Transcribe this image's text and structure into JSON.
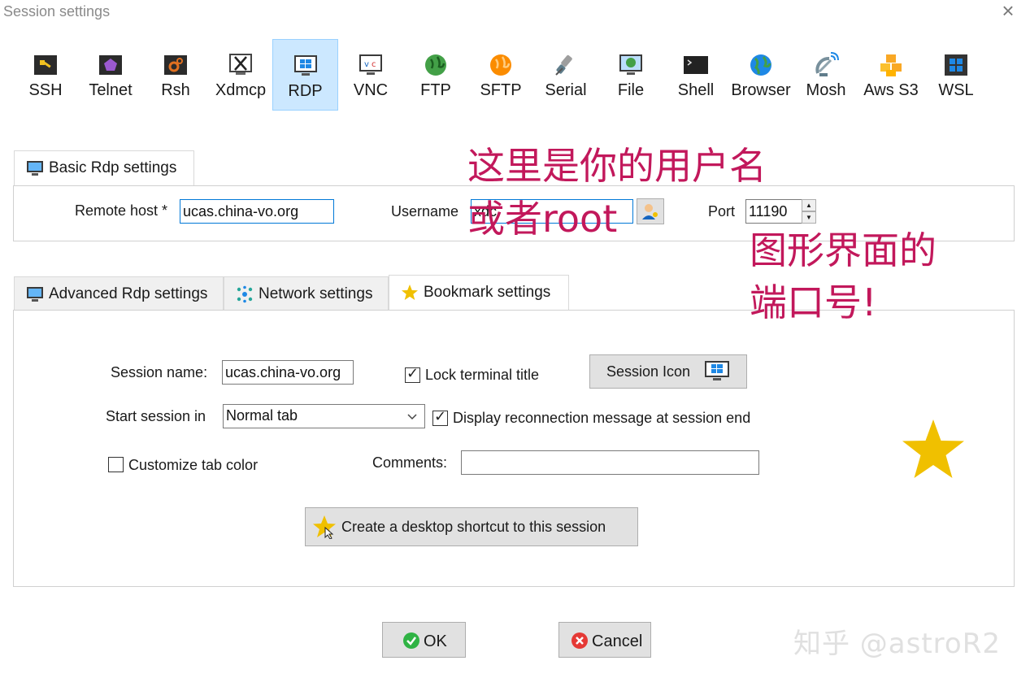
{
  "window": {
    "title": "Session settings",
    "close": "×"
  },
  "session_types": [
    {
      "label": "SSH",
      "icon": "ssh-icon"
    },
    {
      "label": "Telnet",
      "icon": "telnet-icon"
    },
    {
      "label": "Rsh",
      "icon": "rsh-icon"
    },
    {
      "label": "Xdmcp",
      "icon": "xdmcp-icon"
    },
    {
      "label": "RDP",
      "icon": "rdp-icon",
      "selected": true
    },
    {
      "label": "VNC",
      "icon": "vnc-icon"
    },
    {
      "label": "FTP",
      "icon": "ftp-icon"
    },
    {
      "label": "SFTP",
      "icon": "sftp-icon"
    },
    {
      "label": "Serial",
      "icon": "serial-icon"
    },
    {
      "label": "File",
      "icon": "file-icon"
    },
    {
      "label": "Shell",
      "icon": "shell-icon"
    },
    {
      "label": "Browser",
      "icon": "browser-icon"
    },
    {
      "label": "Mosh",
      "icon": "mosh-icon"
    },
    {
      "label": "Aws S3",
      "icon": "aws-s3-icon"
    },
    {
      "label": "WSL",
      "icon": "wsl-icon"
    }
  ],
  "basic": {
    "tab_label": "Basic Rdp settings",
    "remote_host_label": "Remote host *",
    "remote_host_value": "ucas.china-vo.org",
    "username_label": "Username",
    "username_value": "xdc",
    "port_label": "Port",
    "port_value": "11190",
    "spin_up": "▲",
    "spin_down": "▼"
  },
  "tabs": [
    {
      "label": "Advanced Rdp settings",
      "icon": "monitor-icon"
    },
    {
      "label": "Network settings",
      "icon": "network-icon"
    },
    {
      "label": "Bookmark settings",
      "icon": "star-icon",
      "active": true
    }
  ],
  "bookmark": {
    "session_name_label": "Session name:",
    "session_name_value": "ucas.china-vo.org",
    "lock_title_label": "Lock terminal title",
    "lock_title_checked": true,
    "session_icon_button": "Session Icon",
    "start_in_label": "Start session in",
    "start_in_value": "Normal tab",
    "reconnect_label": "Display reconnection message at session end",
    "reconnect_checked": true,
    "customize_color_label": "Customize tab color",
    "customize_color_checked": false,
    "comments_label": "Comments:",
    "comments_value": "",
    "shortcut_button": "Create a desktop shortcut to this session"
  },
  "footer": {
    "ok": "OK",
    "cancel": "Cancel"
  },
  "annotations": {
    "line1": "这里是你的用户名",
    "line2": "或者root",
    "line3": "图形界面的",
    "line4": "端口号!"
  },
  "watermark": "知乎 @astroR2",
  "colors": {
    "selection_bg": "#cce8ff",
    "annotation": "#c2185b",
    "star": "#f0c000",
    "ok_green": "#2fb344",
    "cancel_red": "#e53935"
  }
}
